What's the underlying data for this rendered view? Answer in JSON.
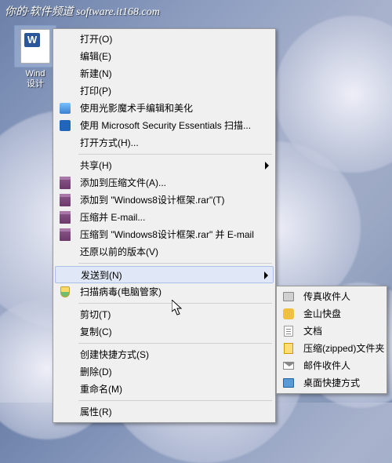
{
  "watermark": "你的·软件频道 software.it168.com",
  "desktop": {
    "file_line1": "Wind",
    "file_line2": "设计"
  },
  "context_menu": {
    "items": [
      {
        "label": "打开(O)",
        "icon": null,
        "arrow": false
      },
      {
        "label": "编辑(E)",
        "icon": null,
        "arrow": false
      },
      {
        "label": "新建(N)",
        "icon": null,
        "arrow": false
      },
      {
        "label": "打印(P)",
        "icon": null,
        "arrow": false
      },
      {
        "label": "使用光影魔术手编辑和美化",
        "icon": "photo",
        "arrow": false
      },
      {
        "label": "使用 Microsoft Security Essentials 扫描...",
        "icon": "mse",
        "arrow": false
      },
      {
        "label": "打开方式(H)...",
        "icon": null,
        "arrow": false
      },
      {
        "sep": true
      },
      {
        "label": "共享(H)",
        "icon": null,
        "arrow": true
      },
      {
        "label": "添加到压缩文件(A)...",
        "icon": "rar",
        "arrow": false
      },
      {
        "label": "添加到 \"Windows8设计框架.rar\"(T)",
        "icon": "rar",
        "arrow": false
      },
      {
        "label": "压缩并 E-mail...",
        "icon": "rar",
        "arrow": false
      },
      {
        "label": "压缩到 \"Windows8设计框架.rar\" 并 E-mail",
        "icon": "rar",
        "arrow": false
      },
      {
        "label": "还原以前的版本(V)",
        "icon": null,
        "arrow": false
      },
      {
        "sep": true
      },
      {
        "label": "发送到(N)",
        "icon": null,
        "arrow": true,
        "highlight": true
      },
      {
        "label": "扫描病毒(电脑管家)",
        "icon": "shield",
        "arrow": false
      },
      {
        "sep": true
      },
      {
        "label": "剪切(T)",
        "icon": null,
        "arrow": false
      },
      {
        "label": "复制(C)",
        "icon": null,
        "arrow": false
      },
      {
        "sep": true
      },
      {
        "label": "创建快捷方式(S)",
        "icon": null,
        "arrow": false
      },
      {
        "label": "删除(D)",
        "icon": null,
        "arrow": false
      },
      {
        "label": "重命名(M)",
        "icon": null,
        "arrow": false
      },
      {
        "sep": true
      },
      {
        "label": "属性(R)",
        "icon": null,
        "arrow": false
      }
    ]
  },
  "submenu": {
    "items": [
      {
        "label": "传真收件人",
        "icon": "fax"
      },
      {
        "label": "金山快盘",
        "icon": "kuaipan"
      },
      {
        "label": "文档",
        "icon": "doc"
      },
      {
        "label": "压缩(zipped)文件夹",
        "icon": "zip"
      },
      {
        "label": "邮件收件人",
        "icon": "mail"
      },
      {
        "label": "桌面快捷方式",
        "icon": "desk"
      }
    ]
  }
}
